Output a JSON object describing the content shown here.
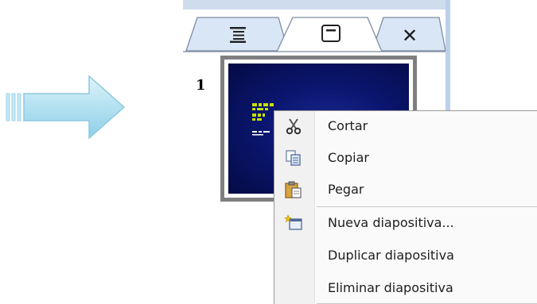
{
  "panel": {
    "tabs": [
      {
        "name": "outline",
        "icon": "outline-icon"
      },
      {
        "name": "slides",
        "icon": "slides-icon"
      }
    ],
    "close_label": "✕",
    "slide_number": "1"
  },
  "context_menu": {
    "items": [
      {
        "label": "Cortar",
        "icon": "scissors-icon"
      },
      {
        "label": "Copiar",
        "icon": "copy-icon"
      },
      {
        "label": "Pegar",
        "icon": "paste-icon"
      },
      {
        "label": "Nueva diapositiva...",
        "icon": "new-slide-icon"
      },
      {
        "label": "Duplicar diapositiva",
        "icon": ""
      },
      {
        "label": "Eliminar diapositiva",
        "icon": ""
      }
    ]
  },
  "colors": {
    "arrow": "#b9e4f2",
    "slide_bg": "#0a1670",
    "slide_text": "#c8e000",
    "panel_border": "#7f7f7f"
  }
}
